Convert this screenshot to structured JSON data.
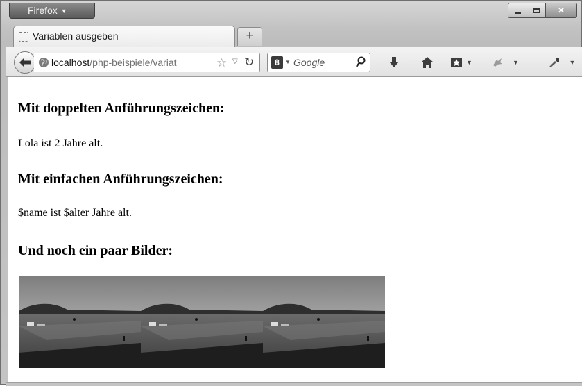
{
  "titlebar": {
    "app_menu_label": "Firefox"
  },
  "tab": {
    "title": "Variablen ausgeben",
    "new_tab_label": "+"
  },
  "navbar": {
    "url_host": "localhost",
    "url_path": "/php-beispiele/variat",
    "search_placeholder": "Google",
    "search_engine_letter": "8"
  },
  "page": {
    "heading_double": "Mit doppelten Anführungszeichen:",
    "text_double": "Lola ist 2 Jahre alt.",
    "heading_single": "Mit einfachen Anführungszeichen:",
    "text_single": "$name ist $alter Jahre alt.",
    "heading_images": "Und noch ein paar Bilder:",
    "image_count": 3
  },
  "icons": [
    "firefox-menu-arrow",
    "blank-favicon",
    "back-arrow-icon",
    "globe-icon",
    "bookmark-star-icon",
    "dropdown-icon",
    "reload-icon",
    "search-engine-icon",
    "search-icon",
    "download-icon",
    "home-icon",
    "bookmarks-icon",
    "addon-icon",
    "developer-icon"
  ],
  "colors": {
    "chrome": "#c4c4c4",
    "content_bg": "#ffffff",
    "text": "#000000"
  }
}
